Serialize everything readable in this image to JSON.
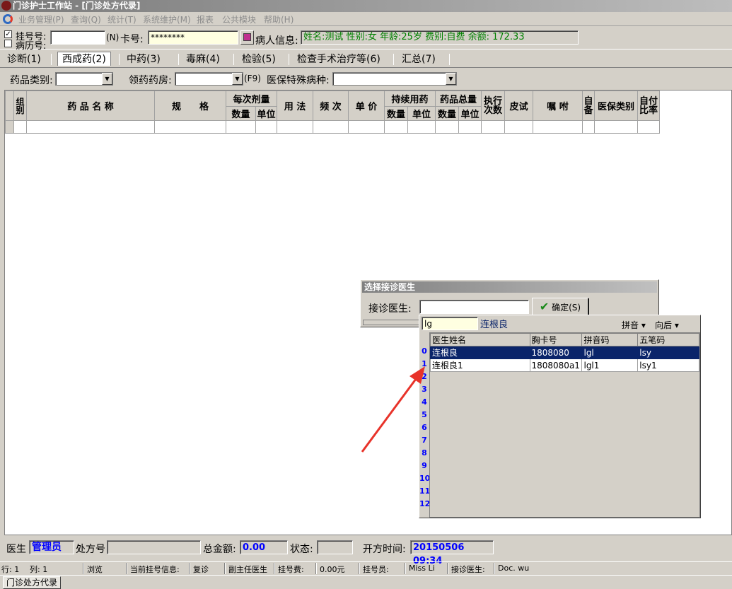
{
  "window": {
    "title": "门诊护士工作站 - [门诊处方代录]"
  },
  "menu": [
    "业务管理(P)",
    "查询(Q)",
    "统计(T)",
    "系统维护(M)",
    "报表",
    "公共模块",
    "帮助(H)"
  ],
  "patient_bar": {
    "reg_no_label": "挂号号:",
    "record_no_label": "病历号:",
    "reg_checked": "✓",
    "reg_no_value": "",
    "n_label": "(N)",
    "card_label": "卡号:",
    "card_value": "********",
    "patient_label": "病人信息:",
    "patient_info": "姓名:测试 性别:女 年龄:25岁 费别:自费 余额: 172.33"
  },
  "tabs": [
    "诊断(1)",
    "西成药(2)",
    "中药(3)",
    "毒麻(4)",
    "检验(5)",
    "检查手术治疗等(6)",
    "汇总(7)"
  ],
  "filter": {
    "drug_category_label": "药品类别:",
    "pharmacy_label": "领药药房:",
    "f9_label": "(F9)",
    "insurance_label": "医保特殊病种:"
  },
  "grid": {
    "headers": {
      "group": "组别",
      "drug_name": "药 品 名 称",
      "spec": "规　　格",
      "dose": "每次剂量",
      "qty": "数量",
      "unit": "单位",
      "usage": "用 法",
      "freq": "频 次",
      "price": "单 价",
      "continuous": "持续用药",
      "total": "药品总量",
      "exec_times": "执行次数",
      "skin_test": "皮试",
      "advice": "嘱 咐",
      "self_supply": "自备",
      "ins_type": "医保类别",
      "self_ratio": "自付比率"
    }
  },
  "bottom": {
    "doctor_label": "医生",
    "doctor_value": "管理员",
    "rx_no_label": "处方号",
    "total_label": "总金额:",
    "total_value": "0.00",
    "state_label": "状态:",
    "time_label": "开方时间:",
    "time_value": "20150506 09:34"
  },
  "status": {
    "row": "行: 1",
    "col": "列: 1",
    "mode": "浏览",
    "reg_info_label": "当前挂号信息:",
    "revisit": "复诊",
    "doctor_title": "副主任医生",
    "fee_label": "挂号费:",
    "fee_value": "0.00元",
    "registrar_label": "挂号员:",
    "registrar_value": "Miss Li",
    "attending_label": "接诊医生:",
    "attending_value": "Doc. wu"
  },
  "taskbar": {
    "item": "门诊处方代录"
  },
  "dialog": {
    "title": "选择接诊医生",
    "field_label": "接诊医生:",
    "ok_label": "确定(S)"
  },
  "popup": {
    "search_value": "lg",
    "match_text": "连根良",
    "pinyin_label": "拼音",
    "direction_label": "向后",
    "columns": [
      "医生姓名",
      "胸卡号",
      "拼音码",
      "五笔码"
    ],
    "rows": [
      {
        "name": "连根良",
        "card": "1808080",
        "pinyin": "lgl",
        "wubi": "lsy"
      },
      {
        "name": "连根良1",
        "card": "1808080a1",
        "pinyin": "lgl1",
        "wubi": "lsy1"
      }
    ],
    "row_numbers": [
      "0",
      "1",
      "2",
      "3",
      "4",
      "5",
      "6",
      "7",
      "8",
      "9",
      "10",
      "11",
      "12"
    ]
  },
  "colors": {
    "accent": "#0a246a",
    "info_text": "#008000",
    "value_text": "#0000ff",
    "arrow": "#e8332a"
  }
}
